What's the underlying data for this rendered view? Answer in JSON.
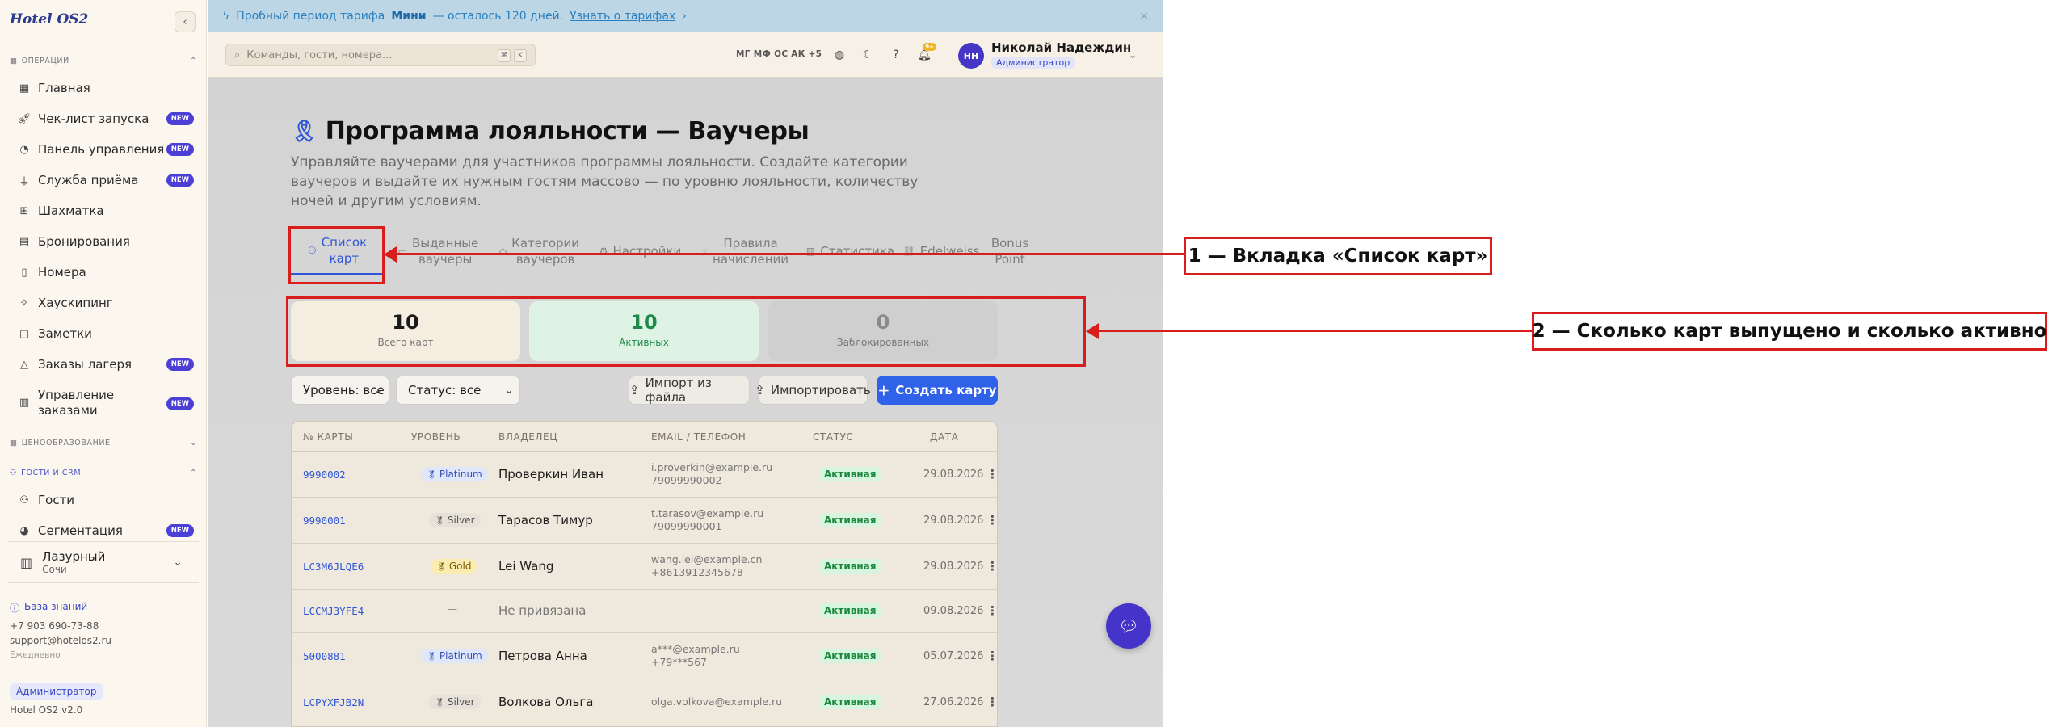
{
  "sidebar": {
    "logo": "Hotel OS2",
    "sections": [
      {
        "label": "ОПЕРАЦИИ"
      },
      {
        "label": "ЦЕНООБРАЗОВАНИЕ"
      },
      {
        "label": "ГОСТИ И CRM"
      }
    ],
    "items": [
      {
        "label": "Главная",
        "icon": "grid-icon",
        "new": false
      },
      {
        "label": "Чек-лист запуска",
        "icon": "rocket-icon",
        "new": true
      },
      {
        "label": "Панель управления",
        "icon": "gauge-icon",
        "new": true
      },
      {
        "label": "Служба приёма",
        "icon": "bell-desk-icon",
        "new": true
      },
      {
        "label": "Шахматка",
        "icon": "table-grid-icon",
        "new": false
      },
      {
        "label": "Бронирования",
        "icon": "clipboard-icon",
        "new": false
      },
      {
        "label": "Номера",
        "icon": "door-icon",
        "new": false
      },
      {
        "label": "Хаускипинг",
        "icon": "sparkle-icon",
        "new": false
      },
      {
        "label": "Заметки",
        "icon": "note-icon",
        "new": false
      },
      {
        "label": "Заказы лагеря",
        "icon": "tent-icon",
        "new": true
      },
      {
        "label": "Управление",
        "label2": "заказами",
        "icon": "orders-icon",
        "new": true
      },
      {
        "label": "Гости",
        "icon": "users-icon",
        "new": false
      },
      {
        "label": "Сегментация",
        "icon": "pie-icon",
        "new": true
      }
    ],
    "new_badge": "NEW",
    "hotel": {
      "name": "Лазурный",
      "city": "Сочи"
    },
    "knowledge_base": "База знаний",
    "phone": "+7 903 690-73-88",
    "email": "support@hotelos2.ru",
    "hours": "Ежедневно",
    "role": "Администратор",
    "version": "Hotel OS2 v2.0"
  },
  "promo": {
    "text_before": "Пробный период тарифа",
    "plan": "Мини",
    "text_after": "— осталось 120 дней.",
    "link": "Узнать о тарифах",
    "link_arrow": "›",
    "close": "×"
  },
  "topbar": {
    "search_placeholder": "Команды, гости, номера...",
    "kbd1": "⌘",
    "kbd2": "K",
    "avatars": "МГ МФ ОС АК +5",
    "notif_count": "9+",
    "user_initials": "НН",
    "user_name": "Николай Надеждин",
    "user_role": "Администратор"
  },
  "page": {
    "title": "Программа лояльности — Ваучеры",
    "subtitle": "Управляйте ваучерами для участников программы лояльности. Создайте категории ваучеров и выдайте их нужным гостям массово — по уровню лояльности, количеству ночей и другим условиям."
  },
  "tabs": [
    {
      "line1": "Список",
      "line2": "карт",
      "active": true
    },
    {
      "line1": "Выданные",
      "line2": "ваучеры",
      "active": false
    },
    {
      "line1": "Категории",
      "line2": "ваучеров",
      "active": false
    },
    {
      "line1": "Настройки",
      "line2": "",
      "active": false
    },
    {
      "line1": "Правила",
      "line2": "начислений",
      "active": false
    },
    {
      "line1": "Статистика",
      "line2": "",
      "active": false
    },
    {
      "line1": "Edelweiss",
      "line2": "",
      "active": false
    },
    {
      "line1": "Bonus",
      "line2": "Point",
      "active": false
    }
  ],
  "stats": [
    {
      "value": "10",
      "label": "Всего карт",
      "color": "#1a1a1a"
    },
    {
      "value": "10",
      "label": "Активных",
      "color": "#1c8a4a"
    },
    {
      "value": "0",
      "label": "Заблокированных",
      "color": "#8a8a8a"
    }
  ],
  "filters": {
    "level": "Уровень: все",
    "status": "Статус: все",
    "import_file": "Импорт из файла",
    "import": "Импортировать",
    "create": "Создать карту"
  },
  "table": {
    "headers": [
      "№ КАРТЫ",
      "УРОВЕНЬ",
      "ВЛАДЕЛЕЦ",
      "EMAIL / ТЕЛЕФОН",
      "СТАТУС",
      "ДАТА"
    ],
    "rows": [
      {
        "no": "9990002",
        "level": "Platinum",
        "owner": "Проверкин Иван",
        "contact1": "i.proverkin@example.ru",
        "contact2": "79099990002",
        "status": "Активная",
        "date": "29.08.2026"
      },
      {
        "no": "9990001",
        "level": "Silver",
        "owner": "Тарасов Тимур",
        "contact1": "t.tarasov@example.ru",
        "contact2": "79099990001",
        "status": "Активная",
        "date": "29.08.2026"
      },
      {
        "no": "LC3M6JLQE6",
        "level": "Gold",
        "owner": "Lei Wang",
        "contact1": "wang.lei@example.cn",
        "contact2": "+8613912345678",
        "status": "Активная",
        "date": "29.08.2026"
      },
      {
        "no": "LCCMJ3YFE4",
        "level": "—",
        "owner": "Не привязана",
        "contact1": "—",
        "contact2": "",
        "status": "Активная",
        "date": "09.08.2026"
      },
      {
        "no": "5000881",
        "level": "Platinum",
        "owner": "Петрова Анна",
        "contact1": "a***@example.ru",
        "contact2": "+79***567",
        "status": "Активная",
        "date": "05.07.2026"
      },
      {
        "no": "LCPYXFJB2N",
        "level": "Silver",
        "owner": "Волкова Ольга",
        "contact1": "olga.volkova@example.ru",
        "contact2": "",
        "status": "Активная",
        "date": "27.06.2026"
      }
    ],
    "level_colors": {
      "Platinum": "#dfe7fb",
      "Silver": "#e6e2da",
      "Gold": "#fbedb0"
    },
    "more": "⋮"
  },
  "annotations": {
    "a1": "1 — Вкладка «Список карт»",
    "a2": "2 — Сколько карт выпущено и сколько активно"
  }
}
